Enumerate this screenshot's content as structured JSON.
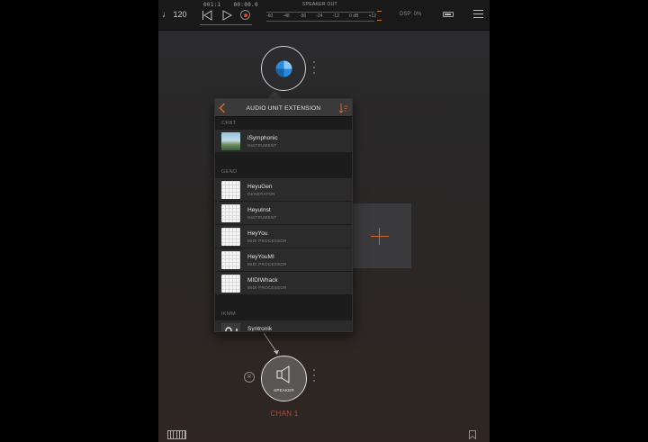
{
  "colors": {
    "accent": "#d06a2c",
    "record": "#e2462f",
    "chan": "#c8442e",
    "logo": "#2a8ae0"
  },
  "topbar": {
    "tempo_note": "♩",
    "tempo": "120",
    "bar_beat": "001:1",
    "time": "00:00.0",
    "meter_label": "SPEAKER OUT",
    "meter_ticks": [
      "-60",
      "-48",
      "-36",
      "-24",
      "-12",
      "0 dB",
      "+12"
    ],
    "dsp": "DSP: 0%"
  },
  "popover": {
    "title": "AUDIO UNIT EXTENSION",
    "sections": [
      {
        "name": "CRBT",
        "items": [
          {
            "name": "iSymphonic",
            "type": "INSTRUMENT",
            "thumb": "photo"
          }
        ]
      },
      {
        "name": "GEND",
        "items": [
          {
            "name": "HeyuGen",
            "type": "GENERATOR",
            "thumb": "grid"
          },
          {
            "name": "HeyuInst",
            "type": "INSTRUMENT",
            "thumb": "grid"
          },
          {
            "name": "HeyYou",
            "type": "MIDI PROCESSOR",
            "thumb": "grid"
          },
          {
            "name": "HeyYouMI",
            "type": "MIDI PROCESSOR",
            "thumb": "grid"
          },
          {
            "name": "MIDIWhack",
            "type": "MIDI PROCESSOR",
            "thumb": "grid"
          }
        ]
      },
      {
        "name": "IKMM",
        "items": [
          {
            "name": "Syntronik",
            "type": "",
            "thumb": "synth"
          }
        ]
      }
    ]
  },
  "speaker": {
    "label": "SPEAKER",
    "badge": "R",
    "channel": "CHAN 1"
  },
  "icons": {
    "menu": "hamburger-icon",
    "keyboard": "piano-keyboard-icon",
    "bookmark": "bookmark-icon"
  }
}
